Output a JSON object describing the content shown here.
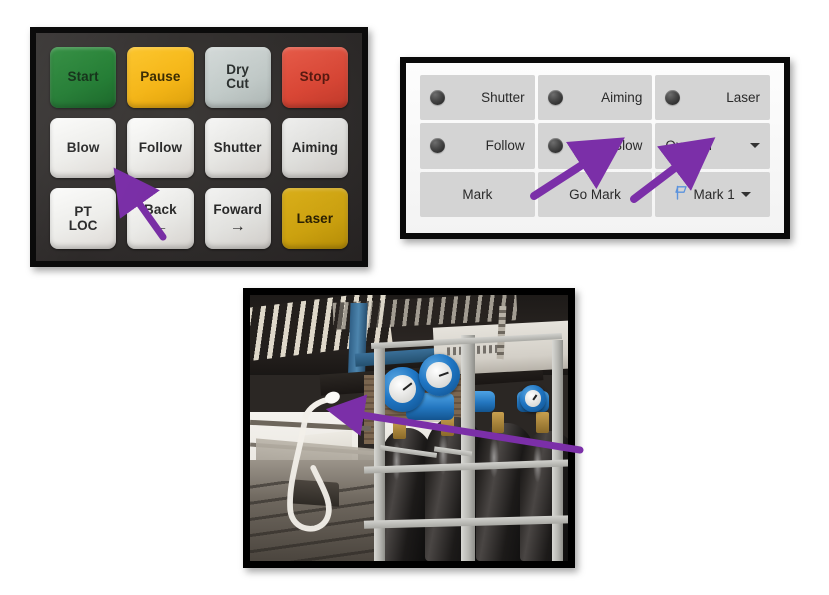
{
  "page": {
    "background": "#ffffff",
    "accent_purple": "#7b2fa8"
  },
  "keypad_panel": {
    "name": "laser cutter physical control keypad",
    "bezel_color": "#0b0b0b",
    "body_color": "#2e2b2a",
    "keys": [
      {
        "label": "Start",
        "line2": "",
        "glyph": "",
        "style": "green",
        "name": "key-start"
      },
      {
        "label": "Pause",
        "line2": "",
        "glyph": "",
        "style": "amber",
        "name": "key-pause"
      },
      {
        "label": "Dry",
        "line2": "Cut",
        "glyph": "",
        "style": "grey",
        "name": "key-dry-cut"
      },
      {
        "label": "Stop",
        "line2": "",
        "glyph": "",
        "style": "red",
        "name": "key-stop"
      },
      {
        "label": "Blow",
        "line2": "",
        "glyph": "",
        "style": "white",
        "name": "key-blow"
      },
      {
        "label": "Follow",
        "line2": "",
        "glyph": "",
        "style": "white",
        "name": "key-follow"
      },
      {
        "label": "Shutter",
        "line2": "",
        "glyph": "",
        "style": "white",
        "name": "key-shutter"
      },
      {
        "label": "Aiming",
        "line2": "",
        "glyph": "",
        "style": "white",
        "name": "key-aiming"
      },
      {
        "label": "PT",
        "line2": "LOC",
        "glyph": "",
        "style": "white",
        "name": "key-pt-loc"
      },
      {
        "label": "Back",
        "line2": "",
        "glyph": "←",
        "style": "white",
        "name": "key-back"
      },
      {
        "label": "Foward",
        "line2": "",
        "glyph": "→",
        "style": "white",
        "name": "key-foward"
      },
      {
        "label": "Laser",
        "line2": "",
        "glyph": "",
        "style": "gold",
        "name": "key-laser"
      }
    ],
    "annotation": {
      "arrow_color": "#7b2fa8",
      "points_to": "Blow"
    }
  },
  "software_panel": {
    "name": "laser control software toolbar",
    "button_bg": "#d4d4d4",
    "panel_bg": "#f7f7f7",
    "buttons": [
      {
        "label": "Shutter",
        "type": "led-toggle",
        "icon": "led-indicator-icon",
        "name": "sw-button-shutter"
      },
      {
        "label": "Aiming",
        "type": "led-toggle",
        "icon": "led-indicator-icon",
        "name": "sw-button-aiming"
      },
      {
        "label": "Laser",
        "type": "led-toggle",
        "icon": "led-indicator-icon",
        "name": "sw-button-laser"
      },
      {
        "label": "Follow",
        "type": "led-toggle",
        "icon": "led-indicator-icon",
        "name": "sw-button-follow"
      },
      {
        "label": "Blow",
        "type": "led-toggle",
        "icon": "led-indicator-icon",
        "name": "sw-button-blow"
      },
      {
        "label": "Oxygen",
        "type": "dropdown",
        "icon": "chevron-down-icon",
        "name": "sw-dropdown-gas"
      },
      {
        "label": "Mark",
        "type": "button",
        "icon": "",
        "name": "sw-button-mark"
      },
      {
        "label": "Go Mark",
        "type": "button",
        "icon": "",
        "name": "sw-button-go-mark"
      },
      {
        "label": "Mark 1",
        "type": "flag-dropdown",
        "icon": "flag-icon",
        "name": "sw-dropdown-mark-1"
      }
    ],
    "annotations": [
      {
        "arrow_color": "#7b2fa8",
        "points_to": "Blow"
      },
      {
        "arrow_color": "#7b2fa8",
        "points_to": "Oxygen"
      }
    ]
  },
  "photo_panel": {
    "name": "workshop photograph of oxygen gas cylinder rack",
    "alt": "Industrial workshop interior with a steel rack holding black gas cylinders fitted with blue pressure regulators and gauges, a white hose coiled in front",
    "annotation": {
      "arrow_color": "#7b2fa8",
      "points_to": "blue regulator on cylinder manifold"
    }
  }
}
